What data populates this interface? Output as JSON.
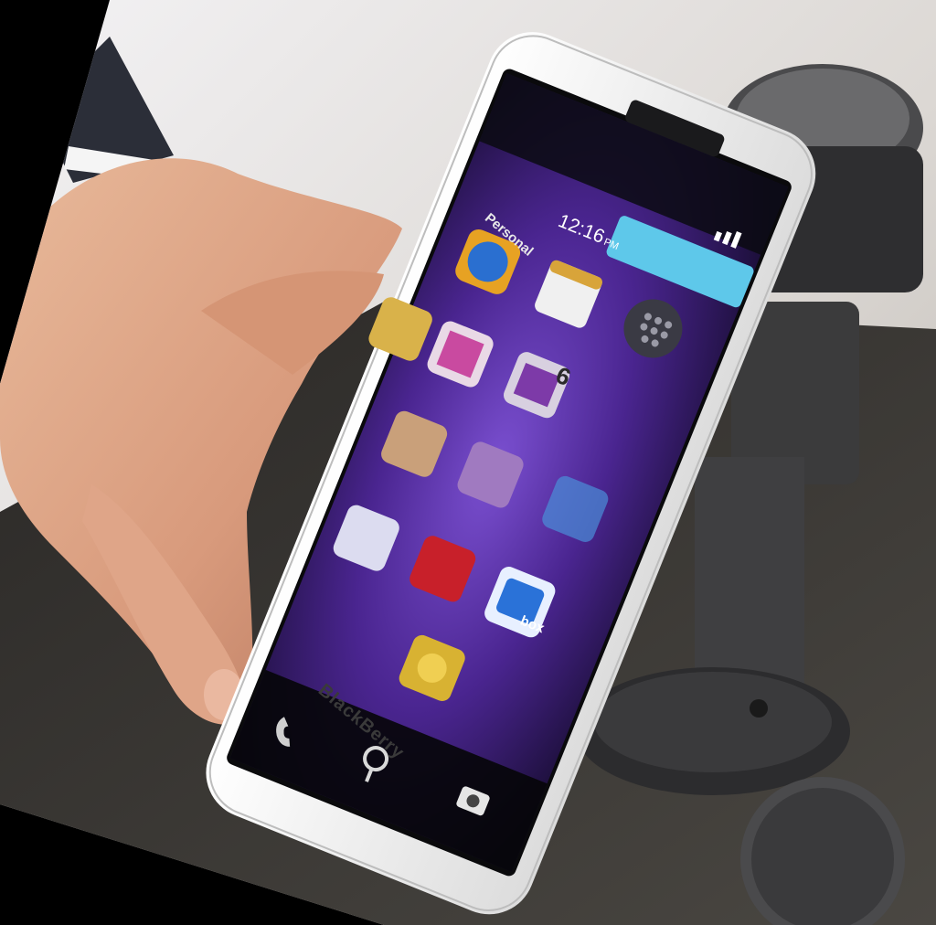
{
  "phone": {
    "screen": {
      "tab_label": "Personal",
      "clock": "12:16",
      "ampm": "PM",
      "calendar_day": "6",
      "box_app_text": "box"
    },
    "brand": "BlackBerry"
  },
  "colors": {
    "wallpaper": "#5a2ea8",
    "phone_body": "#f2f2f2",
    "work_button": "#5ec8ea",
    "background_left": "#e8e8ea",
    "desk": "#3a3834"
  },
  "icons": [
    "phone-icon",
    "search-icon",
    "camera-icon",
    "blackberry-world-icon",
    "calendar-icon",
    "browser-icon",
    "box-icon",
    "adobe-reader-icon"
  ]
}
